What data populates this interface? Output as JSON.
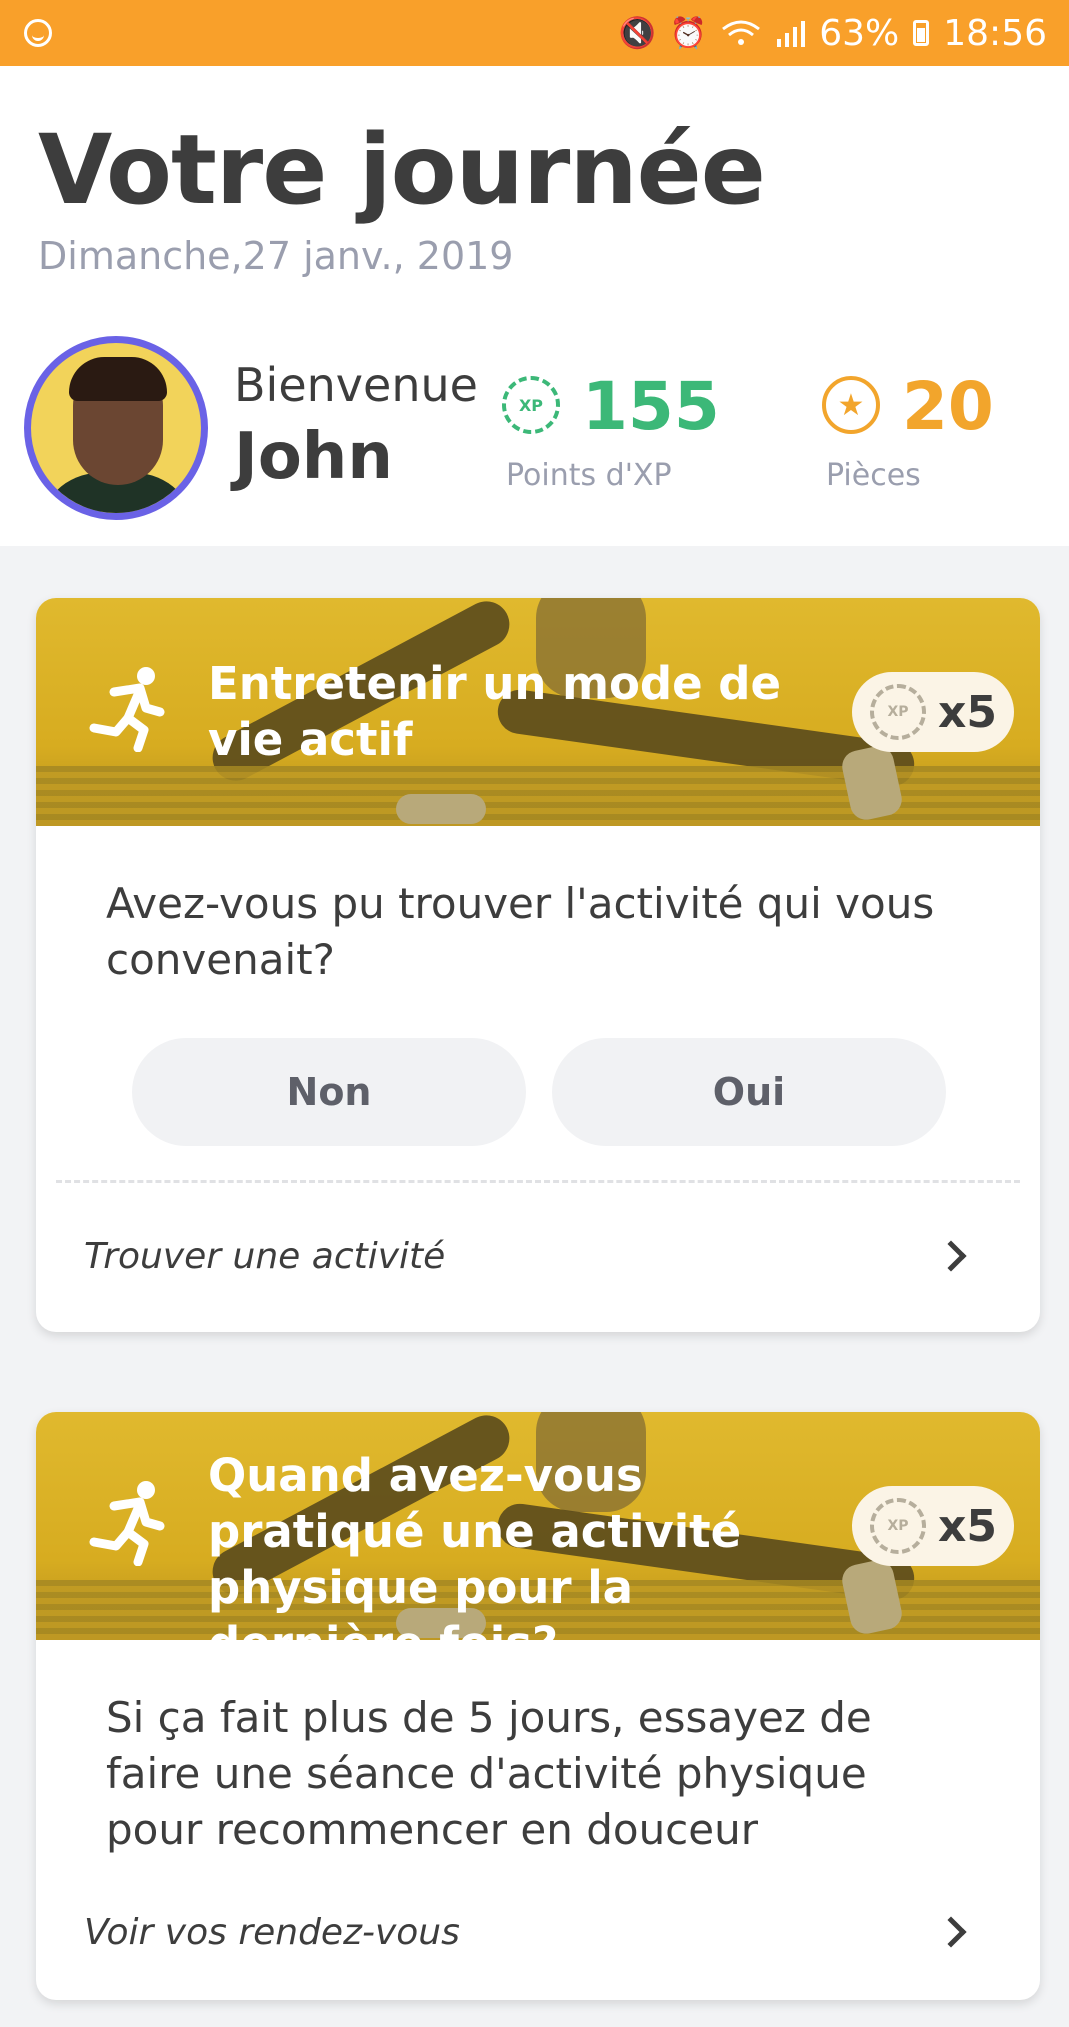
{
  "status_bar": {
    "battery": "63%",
    "time": "18:56",
    "icons": [
      "smiley-icon",
      "mute-icon",
      "alarm-icon",
      "wifi-icon",
      "signal-icon",
      "battery-icon"
    ]
  },
  "header": {
    "title": "Votre journée",
    "date": "Dimanche,27 janv., 2019",
    "welcome": "Bienvenue",
    "user_name": "John",
    "xp": {
      "value": "155",
      "label": "Points d'XP",
      "badge": "XP"
    },
    "coins": {
      "value": "20",
      "label": "Pièces"
    }
  },
  "cards": [
    {
      "title": "Entretenir un mode de vie actif",
      "multiplier": "x5",
      "badge": "XP",
      "question": "Avez-vous pu trouver l'activité qui vous convenait?",
      "buttons": {
        "no": "Non",
        "yes": "Oui"
      },
      "link": "Trouver une activité"
    },
    {
      "title": "Quand avez-vous pratiqué une activité physique pour la dernière fois?",
      "multiplier": "x5",
      "badge": "XP",
      "question": "Si ça fait plus de 5 jours, essayez de faire une séance d'activité physique pour recommencer en douceur",
      "link": "Voir vos rendez-vous"
    }
  ],
  "colors": {
    "status_bar": "#f9a02a",
    "xp_green": "#3cb878",
    "coin_orange": "#f2a52c",
    "avatar_ring": "#6a62e6",
    "banner": "#d7ac20"
  }
}
